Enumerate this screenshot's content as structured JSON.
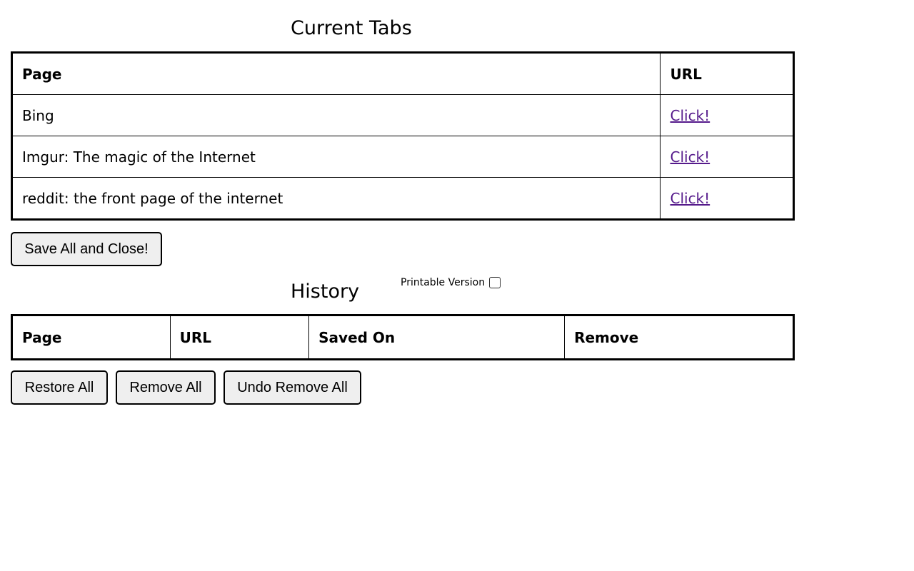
{
  "current": {
    "title": "Current Tabs",
    "headers": {
      "page": "Page",
      "url": "URL"
    },
    "rows": [
      {
        "page": "Bing",
        "link": "Click!"
      },
      {
        "page": "Imgur: The magic of the Internet",
        "link": "Click!"
      },
      {
        "page": "reddit: the front page of the internet",
        "link": "Click!"
      }
    ],
    "save_button": "Save All and Close!"
  },
  "history": {
    "title": "History",
    "printable_label": "Printable Version",
    "printable_checked": false,
    "headers": {
      "page": "Page",
      "url": "URL",
      "saved_on": "Saved On",
      "remove": "Remove"
    },
    "buttons": {
      "restore_all": "Restore All",
      "remove_all": "Remove All",
      "undo_remove_all": "Undo Remove All"
    }
  }
}
